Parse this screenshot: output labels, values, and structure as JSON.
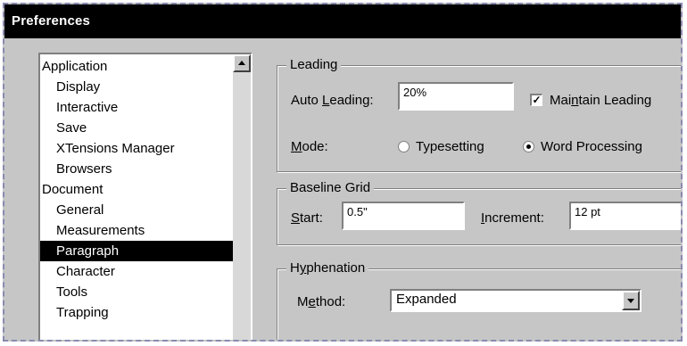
{
  "window": {
    "title": "Preferences"
  },
  "sidebar": {
    "items": [
      {
        "label": "Application",
        "indent": false,
        "selected": false
      },
      {
        "label": "Display",
        "indent": true,
        "selected": false
      },
      {
        "label": "Interactive",
        "indent": true,
        "selected": false
      },
      {
        "label": "Save",
        "indent": true,
        "selected": false
      },
      {
        "label": "XTensions Manager",
        "indent": true,
        "selected": false
      },
      {
        "label": "Browsers",
        "indent": true,
        "selected": false
      },
      {
        "label": "Document",
        "indent": false,
        "selected": false
      },
      {
        "label": "General",
        "indent": true,
        "selected": false
      },
      {
        "label": "Measurements",
        "indent": true,
        "selected": false
      },
      {
        "label": "Paragraph",
        "indent": true,
        "selected": true
      },
      {
        "label": "Character",
        "indent": true,
        "selected": false
      },
      {
        "label": "Tools",
        "indent": true,
        "selected": false
      },
      {
        "label": "Trapping",
        "indent": true,
        "selected": false
      }
    ]
  },
  "leading": {
    "title": "Leading",
    "auto_label_pre": "Auto ",
    "auto_label_ul": "L",
    "auto_label_post": "eading:",
    "auto_value": "20%",
    "maintain_label_pre": "Mai",
    "maintain_label_ul": "n",
    "maintain_label_post": "tain Leading",
    "maintain_checked": "✓",
    "mode_label_ul": "M",
    "mode_label_post": "ode:",
    "mode_typesetting": "Typesetting",
    "mode_wordprocessing": "Word Processing"
  },
  "baseline": {
    "title": "Baseline Grid",
    "start_label_ul": "S",
    "start_label_post": "tart:",
    "start_value": "0.5\"",
    "increment_label_ul": "I",
    "increment_label_post": "ncrement:",
    "increment_value": "12 pt"
  },
  "hyphenation": {
    "title_pre": "H",
    "title_ul": "y",
    "title_post": "phenation",
    "method_label_pre": "M",
    "method_label_ul": "e",
    "method_label_post": "thod:",
    "method_value": "Expanded"
  }
}
